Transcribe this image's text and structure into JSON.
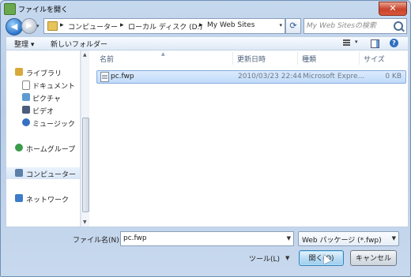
{
  "window": {
    "title": "ファイルを開く",
    "close_glyph": "✕"
  },
  "nav": {
    "back_glyph": "◀",
    "forward_glyph": "▶",
    "breadcrumbs": [
      "コンピューター",
      "ローカル ディスク (D:)",
      "My Web Sites"
    ],
    "separator": "▸",
    "search_placeholder": "My Web Sitesの検索"
  },
  "toolbar": {
    "organize": "整理 ▾",
    "new_folder": "新しいフォルダー",
    "help": "?"
  },
  "sidebar": {
    "items": [
      {
        "label": "ライブラリ",
        "icon": "library-icon"
      },
      {
        "label": "ドキュメント",
        "icon": "document-icon"
      },
      {
        "label": "ピクチャ",
        "icon": "picture-icon"
      },
      {
        "label": "ビデオ",
        "icon": "video-icon"
      },
      {
        "label": "ミュージック",
        "icon": "music-icon"
      },
      {
        "label": "ホームグループ",
        "icon": "homegroup-icon"
      },
      {
        "label": "コンピューター",
        "icon": "computer-icon"
      },
      {
        "label": "ネットワーク",
        "icon": "network-icon"
      }
    ]
  },
  "file_list": {
    "columns": [
      "名前",
      "更新日時",
      "種類",
      "サイズ"
    ],
    "rows": [
      {
        "name": "pc.fwp",
        "modified": "2010/03/23 22:44",
        "type": "Microsoft Expre...",
        "size": "0 KB"
      }
    ]
  },
  "footer": {
    "filename_label": "ファイル名(N):",
    "filename_value": "pc.fwp",
    "filetype_value": "Web パッケージ (*.fwp)",
    "tools_label": "ツール(L)",
    "open_button": "開く(O)",
    "cancel_button": "キャンセル"
  },
  "colors": {
    "accent": "#3c7fb1",
    "selection": "#c1dbfb",
    "close": "#c8432b"
  }
}
